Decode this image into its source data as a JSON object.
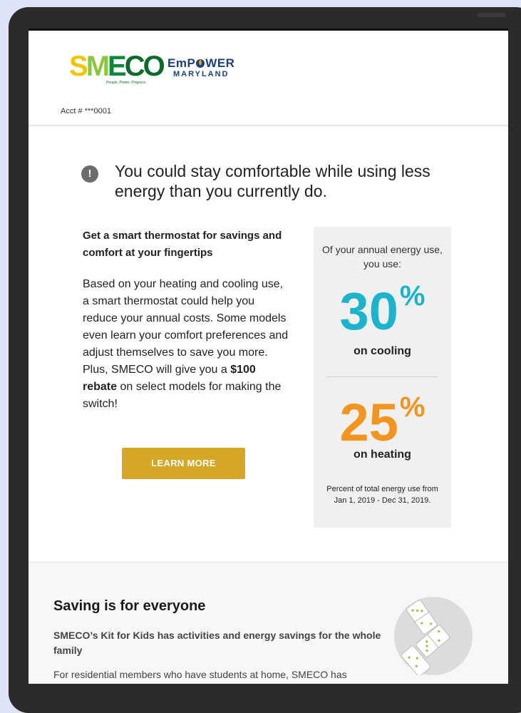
{
  "header": {
    "smeco_tagline": "People. Power. Progress.",
    "empower_line1_a": "EmP",
    "empower_line1_b": "WER",
    "empower_line2": "MARYLAND",
    "account": "Acct # ***0001"
  },
  "alert": {
    "icon": "exclamation-icon",
    "text": "You could stay comfortable while using less energy than you currently do."
  },
  "offer": {
    "heading": "Get a smart thermostat for savings and comfort at your fingertips",
    "body_before": "Based on your heating and cooling use, a smart thermostat could help you reduce your annual costs. Some models even learn your comfort preferences and adjust themselves to save you more. Plus, SMECO will give you a ",
    "body_bold": "$100 rebate",
    "body_after": " on select models for making the switch!",
    "button_label": "LEARN MORE",
    "button_color": "#d5a726"
  },
  "stats": {
    "intro": "Of your annual energy use, you use:",
    "cooling_value": "30",
    "cooling_unit": "%",
    "cooling_label": "on cooling",
    "cooling_color": "#1bb4cc",
    "heating_value": "25",
    "heating_unit": "%",
    "heating_label": "on heating",
    "heating_color": "#f3941f",
    "footnote": "Percent of total energy use from Jan 1, 2019 - Dec 31, 2019."
  },
  "section2": {
    "title": "Saving is for everyone",
    "subtitle": "SMECO’s Kit for Kids has activities and energy savings for the whole family",
    "body": "For residential members who have students at home, SMECO has",
    "illustration": "dominoes-icon"
  }
}
